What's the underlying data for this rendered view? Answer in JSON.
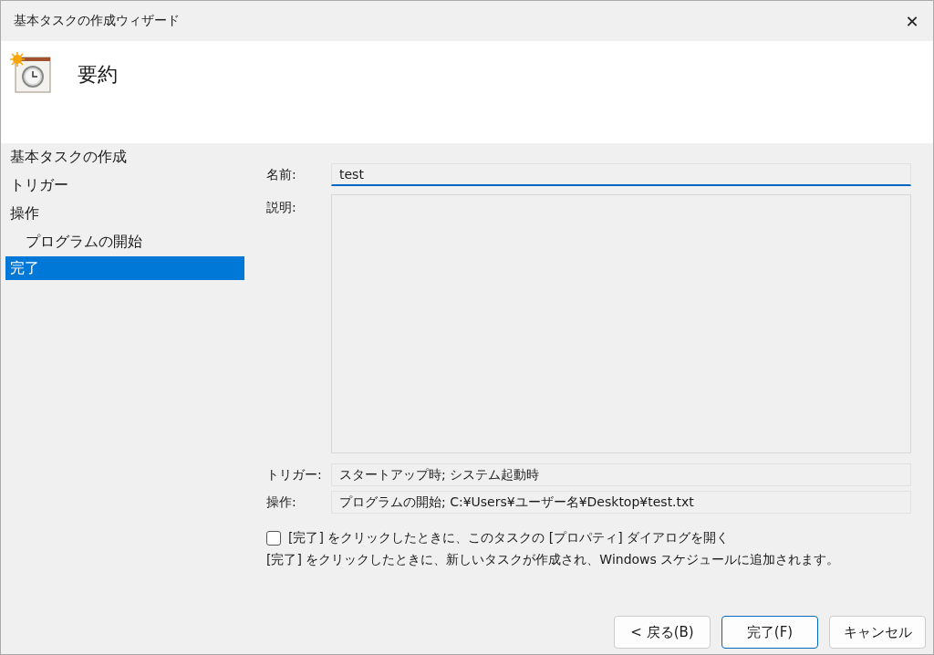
{
  "window": {
    "title": "基本タスクの作成ウィザード",
    "close": "✕"
  },
  "header": {
    "title": "要約"
  },
  "nav": {
    "items": [
      {
        "label": "基本タスクの作成",
        "selected": false
      },
      {
        "label": "トリガー",
        "selected": false
      },
      {
        "label": "操作",
        "selected": false,
        "children": [
          {
            "label": "プログラムの開始",
            "selected": false
          }
        ]
      },
      {
        "label": "完了",
        "selected": true
      }
    ]
  },
  "form": {
    "name": {
      "label": "名前:",
      "value": "test"
    },
    "description": {
      "label": "説明:"
    },
    "trigger": {
      "label": "トリガー:",
      "value": "スタートアップ時; システム起動時"
    },
    "action": {
      "label": "操作:",
      "value": "プログラムの開始; C:¥Users¥ユーザー名¥Desktop¥test.txt"
    },
    "open_properties": {
      "label": "[完了] をクリックしたときに、このタスクの [プロパティ] ダイアログを開く",
      "checked": false
    },
    "note": "[完了] をクリックしたときに、新しいタスクが作成され、Windows スケジュールに追加されます。"
  },
  "buttons": [
    {
      "label": "< 戻る(B)",
      "default": false
    },
    {
      "label": "完了(F)",
      "default": true
    },
    {
      "label": "キャンセル",
      "default": false
    }
  ]
}
